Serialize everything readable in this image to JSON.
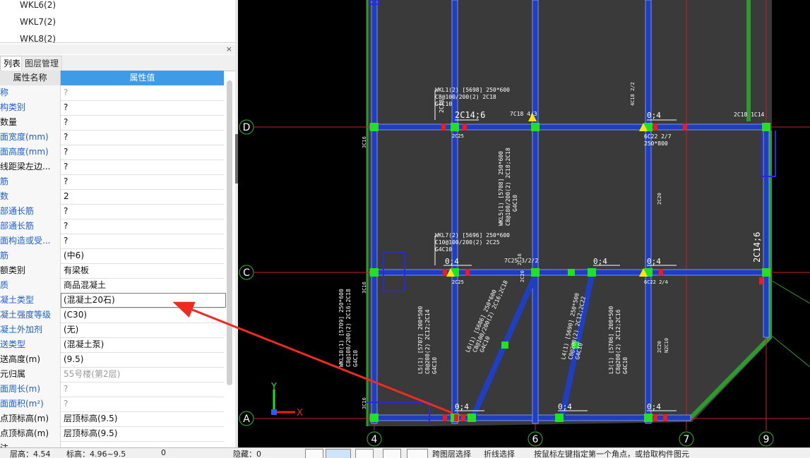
{
  "top_list": [
    "WKL6(2)",
    "WKL7(2)",
    "WKL8(2)"
  ],
  "panel": {
    "close": "×",
    "tabs": [
      "列表",
      "图层管理"
    ],
    "col_name": "属性名称",
    "col_value": "属性值",
    "rows": [
      {
        "name": "称",
        "value": "?",
        "name_color": "blue",
        "value_color": "gray"
      },
      {
        "name": "构类别",
        "value": "?",
        "name_color": "blue",
        "value_color": "black"
      },
      {
        "name": "数量",
        "value": "?",
        "name_color": "black",
        "value_color": "black"
      },
      {
        "name": "面宽度(mm)",
        "value": "?",
        "name_color": "blue",
        "value_color": "black"
      },
      {
        "name": "面高度(mm)",
        "value": "?",
        "name_color": "blue",
        "value_color": "black"
      },
      {
        "name": "线距梁左边...",
        "value": "?",
        "name_color": "black",
        "value_color": "black"
      },
      {
        "name": "筋",
        "value": "?",
        "name_color": "blue",
        "value_color": "black"
      },
      {
        "name": "数",
        "value": "2",
        "name_color": "blue",
        "value_color": "black"
      },
      {
        "name": "部通长筋",
        "value": "?",
        "name_color": "blue",
        "value_color": "black"
      },
      {
        "name": "部通长筋",
        "value": "?",
        "name_color": "blue",
        "value_color": "black"
      },
      {
        "name": "面构造或受...",
        "value": "?",
        "name_color": "blue",
        "value_color": "black"
      },
      {
        "name": "筋",
        "value": "(中6)",
        "name_color": "blue",
        "value_color": "black"
      },
      {
        "name": "额类别",
        "value": "有梁板",
        "name_color": "black",
        "value_color": "black"
      },
      {
        "name": "质",
        "value": "商品混凝土",
        "name_color": "blue",
        "value_color": "black"
      },
      {
        "name": "凝土类型",
        "value": "(混凝土20石)",
        "name_color": "blue",
        "value_color": "black",
        "selected": true
      },
      {
        "name": "凝土强度等级",
        "value": "(C30)",
        "name_color": "blue",
        "value_color": "black"
      },
      {
        "name": "凝土外加剂",
        "value": "(无)",
        "name_color": "blue",
        "value_color": "black"
      },
      {
        "name": "送类型",
        "value": "(混凝土泵)",
        "name_color": "blue",
        "value_color": "black"
      },
      {
        "name": "送高度(m)",
        "value": "(9.5)",
        "name_color": "black",
        "value_color": "black"
      },
      {
        "name": "元归属",
        "value": "55号楼(第2层)",
        "name_color": "black",
        "value_color": "gray"
      },
      {
        "name": "面周长(m)",
        "value": "?",
        "name_color": "blue",
        "value_color": "gray"
      },
      {
        "name": "面面积(m²)",
        "value": "?",
        "name_color": "blue",
        "value_color": "gray"
      },
      {
        "name": "点顶标高(m)",
        "value": "层顶标高(9.5)",
        "name_color": "black",
        "value_color": "black"
      },
      {
        "name": "点顶标高(m)",
        "value": "层顶标高(9.5)",
        "name_color": "black",
        "value_color": "black"
      },
      {
        "name": "注",
        "value": "",
        "name_color": "black",
        "value_color": "black"
      }
    ]
  },
  "bottom_bar": {
    "floor_height": "层高：4.54",
    "elevation": "标高：4.96~9.5",
    "zero": "0",
    "hidden": "隐藏：0",
    "btn_cross": "跨图层选择",
    "btn_poly": "折线选择",
    "hint": "按鼠标左键指定第一个角点，或拾取构件图元"
  },
  "chart_data": {
    "type": "cad-plan",
    "grid_rows": [
      "D",
      "C",
      "A"
    ],
    "grid_cols": [
      "4",
      "6",
      "7",
      "9"
    ],
    "axis_x": "X",
    "axis_y": "Y",
    "beam_labels": [
      {
        "id": "lbl1",
        "text": "WKL1(2) [5698] 250*600"
      },
      {
        "id": "lbl2",
        "text": "C8@100/200(2) 2C18"
      },
      {
        "id": "lbl3",
        "text": "G4C10"
      },
      {
        "id": "lbl4",
        "text": "2C14;6"
      },
      {
        "id": "lbl5",
        "text": "2C18"
      },
      {
        "id": "lbl6",
        "text": "2C25"
      },
      {
        "id": "lbl7",
        "text": "7C18 4/3"
      },
      {
        "id": "lbl8",
        "text": "0;4"
      },
      {
        "id": "lbl9",
        "text": "4C18 2/2"
      },
      {
        "id": "lbl10",
        "text": "6C22 2/7"
      },
      {
        "id": "lbl11",
        "text": "250*800"
      },
      {
        "id": "lbl12",
        "text": "2C18 1C14"
      },
      {
        "id": "lbl13",
        "text": "WKL7(2) [5696] 250*600"
      },
      {
        "id": "lbl14",
        "text": "C10@100/200(2) 2C25"
      },
      {
        "id": "lbl15",
        "text": "G4C10"
      },
      {
        "id": "lbl16",
        "text": "0;4"
      },
      {
        "id": "lbl17",
        "text": "7C25 3/2/2"
      },
      {
        "id": "lbl18",
        "text": "0;4"
      },
      {
        "id": "lbl19",
        "text": "0;4"
      },
      {
        "id": "lbl20",
        "text": "6C22 2/4"
      },
      {
        "id": "lbl21",
        "text": "2C14;6"
      },
      {
        "id": "lbl22",
        "text": "2C25"
      },
      {
        "id": "lbl23",
        "text": "0;4"
      },
      {
        "id": "lbl24",
        "text": "0;4"
      },
      {
        "id": "lbl25",
        "text": "0;4"
      },
      {
        "id": "lbl26",
        "text": "WKL5(1) [5708] 250*600"
      },
      {
        "id": "lbl27",
        "text": "C8@100/200(2) 2C18;2C18"
      },
      {
        "id": "lbl28",
        "text": "G4C10"
      },
      {
        "id": "lbl29",
        "text": "WKL10(1) [5709] 250*600"
      },
      {
        "id": "lbl30",
        "text": "C8@100/200(2) 2C16;2C18"
      },
      {
        "id": "lbl31",
        "text": "G4C10"
      },
      {
        "id": "lbl32",
        "text": "L5(1) [5707] 200*500"
      },
      {
        "id": "lbl33",
        "text": "C8@200(2) 2C12;2C14"
      },
      {
        "id": "lbl34",
        "text": "G4C10"
      },
      {
        "id": "lbl35",
        "text": "L6(1) [5686] 250*600"
      },
      {
        "id": "lbl36",
        "text": "C8@100/200(2) 2C16;2C18"
      },
      {
        "id": "lbl37",
        "text": "G4C10"
      },
      {
        "id": "lbl38",
        "text": "L4(1) [5690] 250*500"
      },
      {
        "id": "lbl39",
        "text": "C8@200(2) 2C12;2C22"
      },
      {
        "id": "lbl40",
        "text": "G4C10"
      },
      {
        "id": "lbl41",
        "text": "L3(1) [5706] 200*500"
      },
      {
        "id": "lbl42",
        "text": "C8@200(2) 2C12;2C16"
      },
      {
        "id": "lbl43",
        "text": "G4C10"
      },
      {
        "id": "lbl44",
        "text": "2C20"
      },
      {
        "id": "lbl45",
        "text": "2C20"
      },
      {
        "id": "lbl46",
        "text": "2C20"
      },
      {
        "id": "lbl47",
        "text": "N2C10"
      },
      {
        "id": "lbl48",
        "text": "3C16"
      },
      {
        "id": "lbl49",
        "text": "3C16"
      },
      {
        "id": "lbl50",
        "text": "3C16"
      },
      {
        "id": "lbl51",
        "text": "2C16"
      }
    ]
  }
}
